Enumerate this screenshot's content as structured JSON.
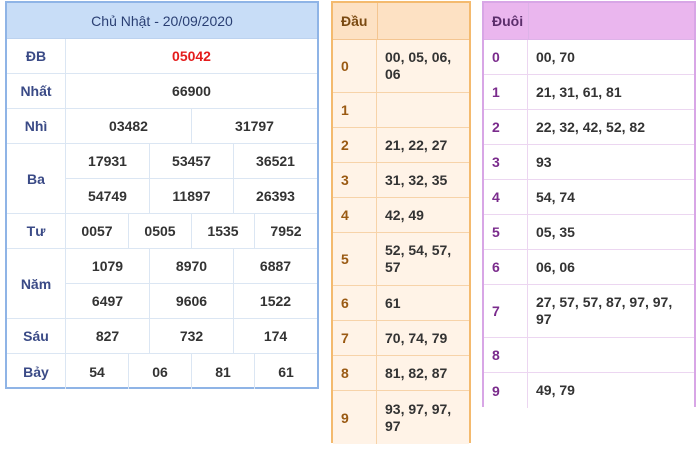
{
  "results": {
    "title": "Chủ Nhật - 20/09/2020",
    "prizes": [
      {
        "label": "ĐB",
        "lines": [
          [
            "05042"
          ]
        ]
      },
      {
        "label": "Nhất",
        "lines": [
          [
            "66900"
          ]
        ]
      },
      {
        "label": "Nhì",
        "lines": [
          [
            "03482",
            "31797"
          ]
        ]
      },
      {
        "label": "Ba",
        "lines": [
          [
            "17931",
            "53457",
            "36521"
          ],
          [
            "54749",
            "11897",
            "26393"
          ]
        ]
      },
      {
        "label": "Tư",
        "lines": [
          [
            "0057",
            "0505",
            "1535",
            "7952"
          ]
        ]
      },
      {
        "label": "Năm",
        "lines": [
          [
            "1079",
            "8970",
            "6887"
          ],
          [
            "6497",
            "9606",
            "1522"
          ]
        ]
      },
      {
        "label": "Sáu",
        "lines": [
          [
            "827",
            "732",
            "174"
          ]
        ]
      },
      {
        "label": "Bảy",
        "lines": [
          [
            "54",
            "06",
            "81",
            "61"
          ]
        ]
      }
    ]
  },
  "dau": {
    "header": "Đầu",
    "rows": [
      {
        "key": "0",
        "values": "00, 05, 06, 06"
      },
      {
        "key": "1",
        "values": ""
      },
      {
        "key": "2",
        "values": "21, 22, 27"
      },
      {
        "key": "3",
        "values": "31, 32, 35"
      },
      {
        "key": "4",
        "values": "42, 49"
      },
      {
        "key": "5",
        "values": "52, 54, 57, 57"
      },
      {
        "key": "6",
        "values": "61"
      },
      {
        "key": "7",
        "values": "70, 74, 79"
      },
      {
        "key": "8",
        "values": "81, 82, 87"
      },
      {
        "key": "9",
        "values": "93, 97, 97, 97"
      }
    ]
  },
  "duoi": {
    "header": "Đuôi",
    "rows": [
      {
        "key": "0",
        "values": "00, 70"
      },
      {
        "key": "1",
        "values": "21, 31, 61, 81"
      },
      {
        "key": "2",
        "values": "22, 32, 42, 52, 82"
      },
      {
        "key": "3",
        "values": "93"
      },
      {
        "key": "4",
        "values": "54, 74"
      },
      {
        "key": "5",
        "values": "05, 35"
      },
      {
        "key": "6",
        "values": "06, 06"
      },
      {
        "key": "7",
        "values": "27, 57, 57, 87, 97, 97, 97"
      },
      {
        "key": "8",
        "values": ""
      },
      {
        "key": "9",
        "values": "49, 79"
      }
    ]
  },
  "colors": {
    "special_prize": "#e41c1c",
    "results_border": "#8fb4e6",
    "dau_border": "#f4ba6e",
    "duoi_border": "#d8a6e6"
  }
}
